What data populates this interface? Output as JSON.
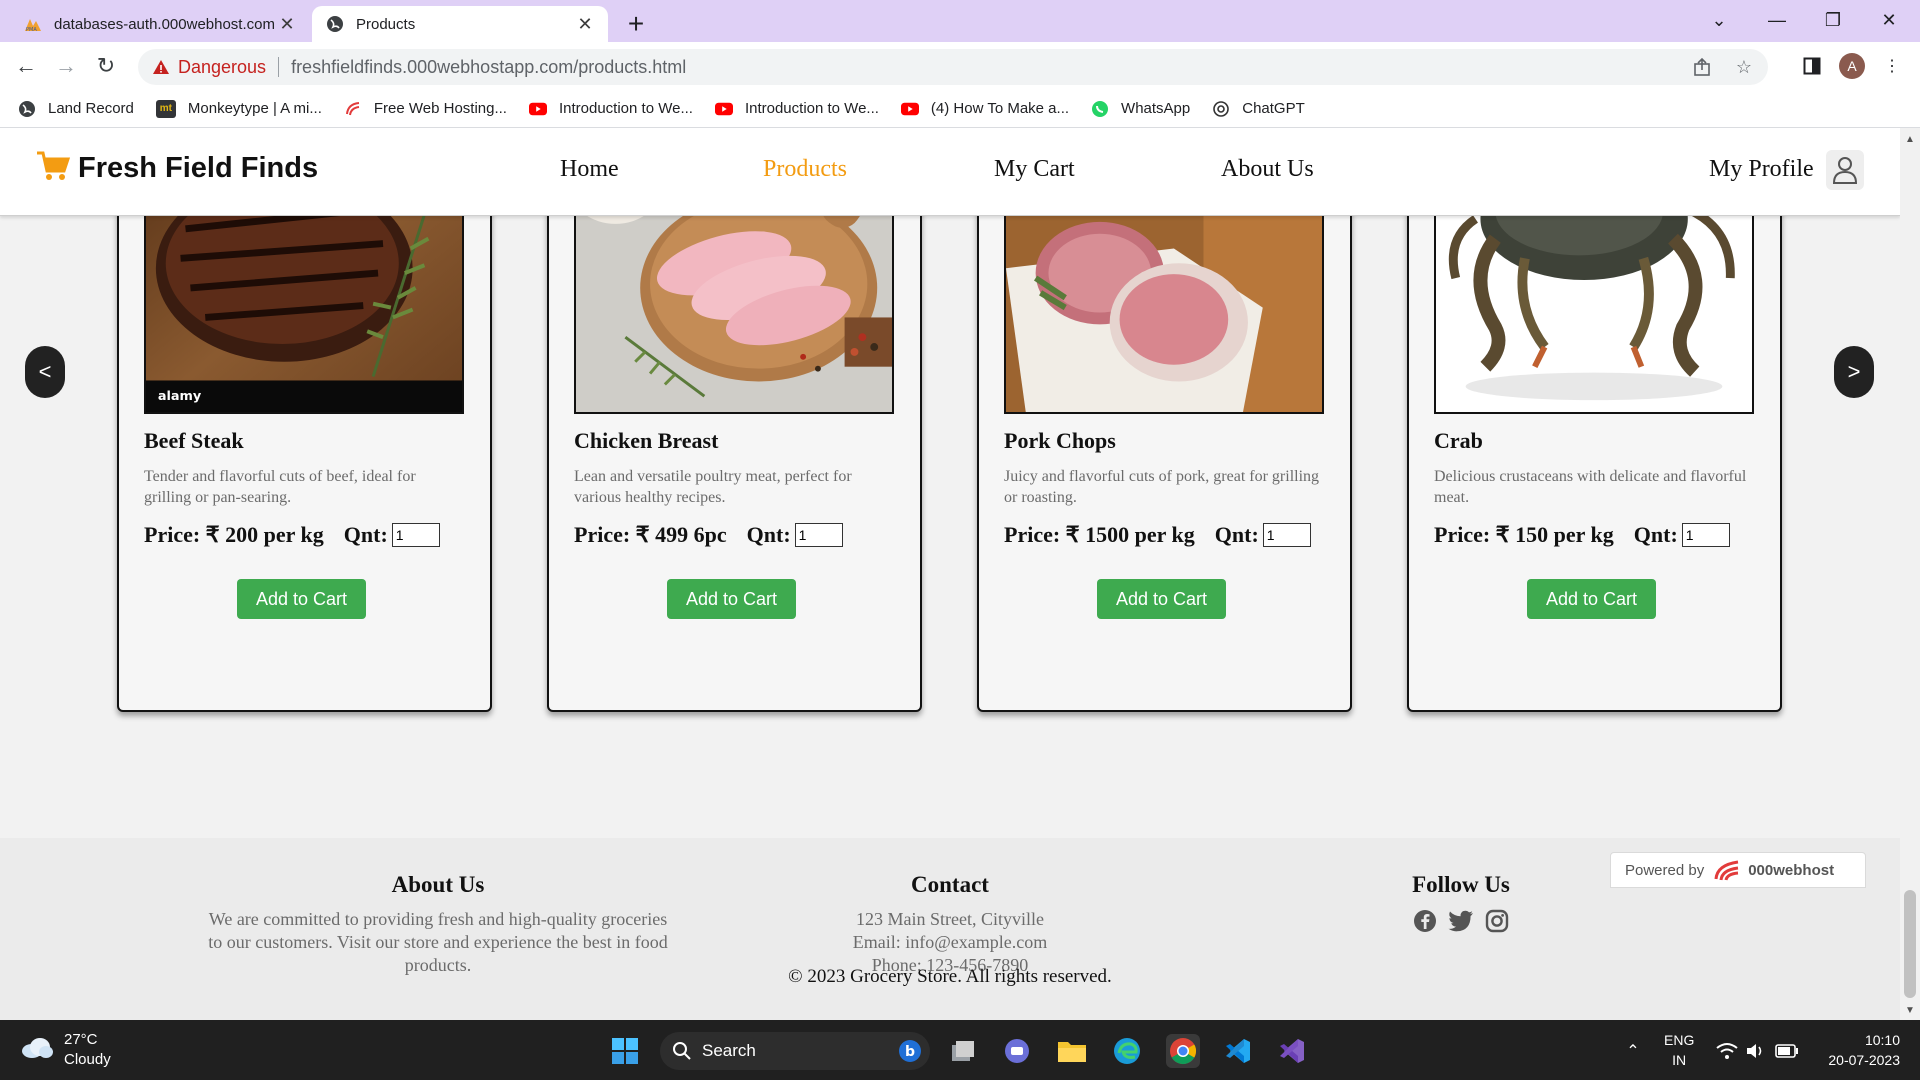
{
  "browser": {
    "tabs": [
      {
        "title": "databases-auth.000webhost.com"
      },
      {
        "title": "Products"
      }
    ],
    "security_label": "Dangerous",
    "url": "freshfieldfinds.000webhostapp.com/products.html",
    "profile_initial": "A",
    "bookmarks": [
      {
        "label": "Land Record",
        "icon": "globe-icon"
      },
      {
        "label": "Monkeytype | A mi...",
        "icon": "monkeytype-icon"
      },
      {
        "label": "Free Web Hosting...",
        "icon": "000webhost-icon"
      },
      {
        "label": "Introduction to We...",
        "icon": "youtube-icon"
      },
      {
        "label": "Introduction to We...",
        "icon": "youtube-icon"
      },
      {
        "label": "(4) How To Make a...",
        "icon": "youtube-icon"
      },
      {
        "label": "WhatsApp",
        "icon": "whatsapp-icon"
      },
      {
        "label": "ChatGPT",
        "icon": "chatgpt-icon"
      }
    ]
  },
  "site": {
    "brand": "Fresh Field Finds",
    "nav": [
      {
        "label": "Home",
        "active": false
      },
      {
        "label": "Products",
        "active": true
      },
      {
        "label": "My Cart",
        "active": false
      },
      {
        "label": "About Us",
        "active": false
      }
    ],
    "profile_label": "My Profile",
    "accent_color": "#f39c12",
    "button_color": "#3eaa4f",
    "carousel": {
      "prev": "<",
      "next": ">"
    },
    "products": [
      {
        "name": "Beef Steak",
        "description": "Tender and flavorful cuts of beef, ideal for grilling or pan-searing.",
        "price": "Price: ₹ 200 per kg",
        "qnt_label": "Qnt:",
        "qnt_value": "1",
        "button": "Add to Cart",
        "image": "beef-steak-photo"
      },
      {
        "name": "Chicken Breast",
        "description": "Lean and versatile poultry meat, perfect for various healthy recipes.",
        "price": "Price: ₹ 499 6pc",
        "qnt_label": "Qnt:",
        "qnt_value": "1",
        "button": "Add to Cart",
        "image": "chicken-breast-photo"
      },
      {
        "name": "Pork Chops",
        "description": "Juicy and flavorful cuts of pork, great for grilling or roasting.",
        "price": "Price: ₹ 1500 per kg",
        "qnt_label": "Qnt:",
        "qnt_value": "1",
        "button": "Add to Cart",
        "image": "pork-chops-photo"
      },
      {
        "name": "Crab",
        "description": "Delicious crustaceans with delicate and flavorful meat.",
        "price": "Price: ₹ 150 per kg",
        "qnt_label": "Qnt:",
        "qnt_value": "1",
        "button": "Add to Cart",
        "image": "crab-photo"
      }
    ],
    "footer": {
      "about_title": "About Us",
      "about_text": "We are committed to providing fresh and high-quality groceries to our customers. Visit our store and experience the best in food products.",
      "contact_title": "Contact",
      "contact_lines": [
        "123 Main Street, Cityville",
        "Email: info@example.com",
        "Phone: 123-456-7890"
      ],
      "follow_title": "Follow Us",
      "social": [
        "facebook-icon",
        "twitter-icon",
        "instagram-icon"
      ],
      "copyright": "© 2023 Grocery Store. All rights reserved."
    },
    "powered_by": {
      "label": "Powered by",
      "brand": "000webhost"
    }
  },
  "taskbar": {
    "temperature": "27°C",
    "condition": "Cloudy",
    "search_label": "Search",
    "language_line1": "ENG",
    "language_line2": "IN",
    "time": "10:10",
    "date": "20-07-2023"
  }
}
